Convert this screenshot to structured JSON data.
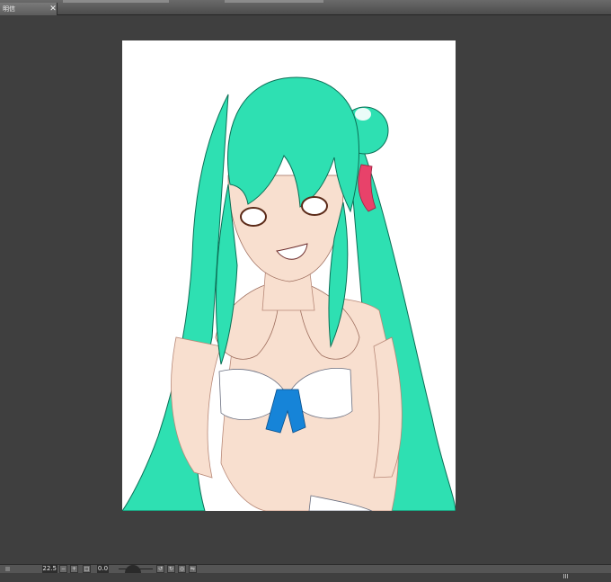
{
  "document_tab": {
    "title": "明信",
    "close_glyph": "✕"
  },
  "status_bar": {
    "zoom": "22.5",
    "rotation": "0.0"
  },
  "icons": [
    "close-icon",
    "zoom-out-icon",
    "zoom-in-icon",
    "fit-screen-icon",
    "rotate-left-icon",
    "rotate-right-icon",
    "reset-rotation-icon",
    "flip-icon",
    "resize-grip-icon"
  ],
  "colors": {
    "workspace_bg": "#3f3f3f",
    "paper": "#ffffff",
    "hair": "#2ee0b2",
    "skin": "#f8dfcf",
    "ribbon_red": "#e8426a",
    "ribbon_blue": "#1684d8"
  }
}
